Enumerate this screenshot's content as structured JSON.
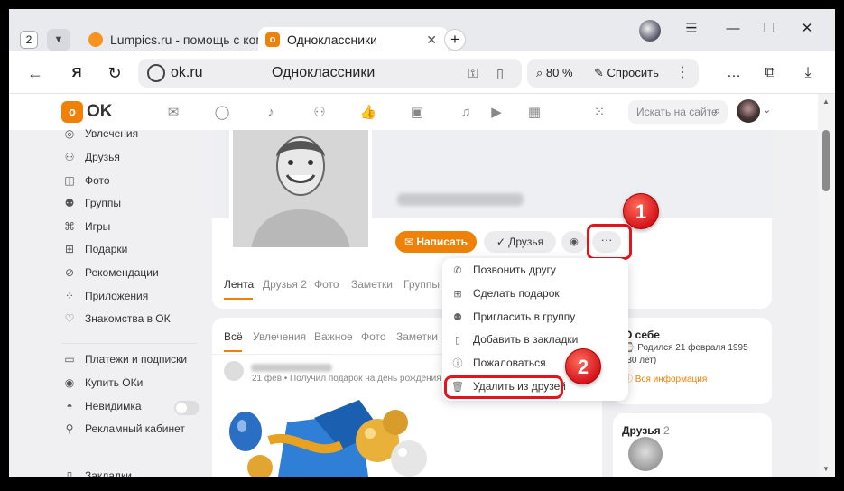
{
  "browser": {
    "tab_count": "2",
    "tabs": [
      {
        "title": "Lumpics.ru - помощь с ком",
        "active": false
      },
      {
        "title": "Одноклассники",
        "active": true
      }
    ],
    "url": "ok.ru",
    "page_title": "Одноклассники",
    "zoom": "80 %",
    "ask_label": "Спросить"
  },
  "header": {
    "logo_text": "OK",
    "search_placeholder": "Искать на сайте"
  },
  "sidebar": {
    "items": [
      {
        "label": "Увлечения",
        "icon": "hobby-icon"
      },
      {
        "label": "Друзья",
        "icon": "friends-icon"
      },
      {
        "label": "Фото",
        "icon": "photo-icon"
      },
      {
        "label": "Группы",
        "icon": "groups-icon"
      },
      {
        "label": "Игры",
        "icon": "games-icon"
      },
      {
        "label": "Подарки",
        "icon": "gift-icon"
      },
      {
        "label": "Рекомендации",
        "icon": "recommendations-icon"
      },
      {
        "label": "Приложения",
        "icon": "apps-icon"
      },
      {
        "label": "Знакомства в ОК",
        "icon": "dating-icon"
      }
    ],
    "items2": [
      {
        "label": "Платежи и подписки",
        "icon": "payments-icon"
      },
      {
        "label": "Купить ОКи",
        "icon": "coins-icon"
      },
      {
        "label": "Невидимка",
        "icon": "invisible-icon"
      },
      {
        "label": "Рекламный кабинет",
        "icon": "ads-icon"
      },
      {
        "label": "Закладки",
        "icon": "bookmark-icon"
      }
    ]
  },
  "profile": {
    "write_button": "Написать",
    "friends_button": "Друзья",
    "tabs": [
      "Лента",
      "Друзья 2",
      "Фото",
      "Заметки",
      "Группы"
    ]
  },
  "feed": {
    "tabs": [
      "Всё",
      "Увлечения",
      "Важное",
      "Фото",
      "Заметки"
    ],
    "post_meta": "21 фев • Получил подарок на день рождения от"
  },
  "about": {
    "title": "О себе",
    "birth": "Родился 21 февраля 1995 (30 лет)",
    "all_info": "Вся информация"
  },
  "friends_block": {
    "title": "Друзья",
    "count": "2"
  },
  "dropdown": {
    "items": [
      {
        "label": "Позвонить другу",
        "icon": "phone-icon"
      },
      {
        "label": "Сделать подарок",
        "icon": "gift-icon"
      },
      {
        "label": "Пригласить в группу",
        "icon": "group-invite-icon"
      },
      {
        "label": "Добавить в закладки",
        "icon": "bookmark-icon"
      },
      {
        "label": "Пожаловаться",
        "icon": "report-icon"
      },
      {
        "label": "Удалить из друзей",
        "icon": "trash-icon"
      }
    ]
  },
  "annotations": {
    "step1": "1",
    "step2": "2"
  },
  "colors": {
    "accent": "#ee8208",
    "highlight": "#e3141b"
  }
}
